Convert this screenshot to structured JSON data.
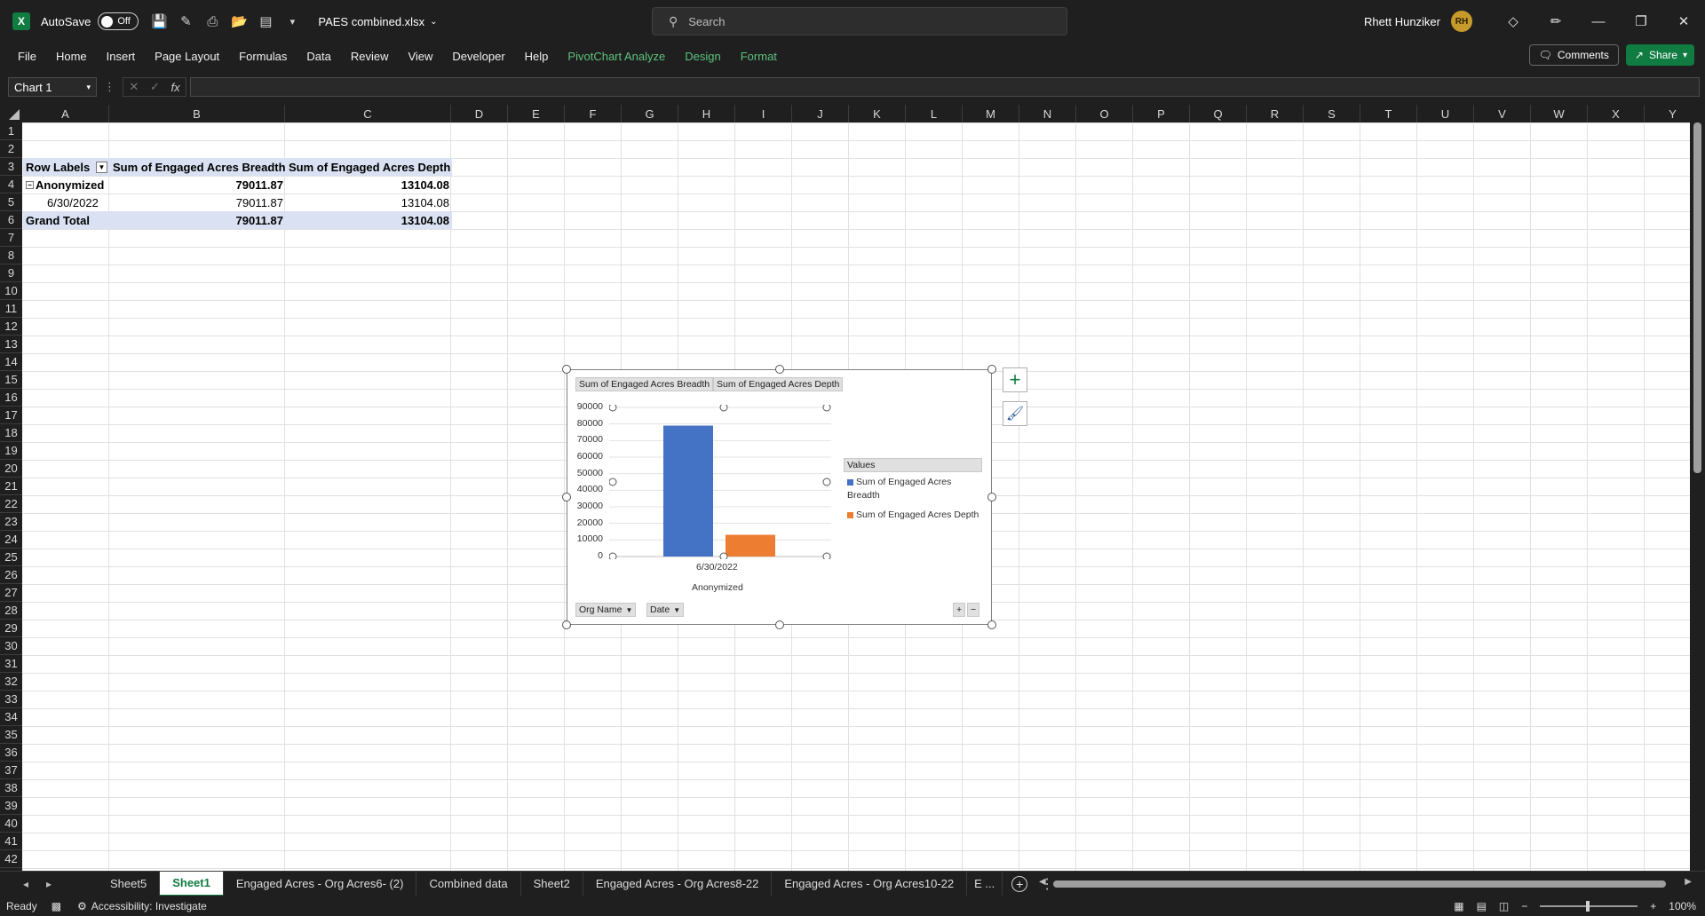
{
  "titlebar": {
    "autosave_label": "AutoSave",
    "autosave_state": "Off",
    "filename": "PAES combined.xlsx",
    "search_placeholder": "Search",
    "user_name": "Rhett Hunziker",
    "user_initials": "RH"
  },
  "menu": {
    "items": [
      "File",
      "Home",
      "Insert",
      "Page Layout",
      "Formulas",
      "Data",
      "Review",
      "View",
      "Developer",
      "Help"
    ],
    "context_items": [
      "PivotChart Analyze",
      "Design",
      "Format"
    ],
    "comments_label": "Comments",
    "share_label": "Share"
  },
  "formula_bar": {
    "name_box": "Chart 1",
    "fx": "fx",
    "value": ""
  },
  "columns": [
    "A",
    "B",
    "C",
    "D",
    "E",
    "F",
    "G",
    "H",
    "I",
    "J",
    "K",
    "L",
    "M",
    "N",
    "O",
    "P",
    "Q",
    "R",
    "S",
    "T",
    "U",
    "V",
    "W",
    "X",
    "Y"
  ],
  "rows": [
    "1",
    "2",
    "3",
    "4",
    "5",
    "6",
    "7",
    "8",
    "9",
    "10",
    "11",
    "12",
    "13",
    "14",
    "15",
    "16",
    "17",
    "18",
    "19",
    "20",
    "21",
    "22",
    "23",
    "24",
    "25",
    "26",
    "27",
    "28",
    "29",
    "30",
    "31",
    "32",
    "33",
    "34",
    "35",
    "36",
    "37",
    "38",
    "39",
    "40",
    "41",
    "42"
  ],
  "pivot": {
    "headers": [
      "Row Labels",
      "Sum of Engaged Acres Breadth",
      "Sum of Engaged Acres Depth"
    ],
    "group": {
      "label": "Anonymized",
      "breadth": "79011.87",
      "depth": "13104.08"
    },
    "item": {
      "label": "6/30/2022",
      "breadth": "79011.87",
      "depth": "13104.08"
    },
    "total": {
      "label": "Grand Total",
      "breadth": "79011.87",
      "depth": "13104.08"
    }
  },
  "chart_data": {
    "type": "bar",
    "categories": [
      "6/30/2022"
    ],
    "category_group": "Anonymized",
    "series": [
      {
        "name": "Sum of Engaged Acres Breadth",
        "values": [
          79011.87
        ],
        "color": "#4472c4"
      },
      {
        "name": "Sum of Engaged Acres Depth",
        "values": [
          13104.08
        ],
        "color": "#ed7d31"
      }
    ],
    "ylim": [
      0,
      90000
    ],
    "yticks": [
      "90000",
      "80000",
      "70000",
      "60000",
      "50000",
      "40000",
      "30000",
      "20000",
      "10000",
      "0"
    ],
    "legend_title": "Values",
    "legend_position": "right",
    "value_field_buttons": [
      "Sum of Engaged Acres Breadth",
      "Sum of Engaged Acres Depth"
    ],
    "axis_field_buttons": [
      "Org Name",
      "Date"
    ],
    "grid": true
  },
  "sheet_tabs": [
    "Sheet5",
    "Sheet1",
    "Engaged Acres - Org Acres6- (2)",
    "Combined data",
    "Sheet2",
    "Engaged Acres - Org Acres8-22",
    "Engaged Acres - Org Acres10-22",
    "E ..."
  ],
  "active_tab": "Sheet1",
  "status": {
    "ready": "Ready",
    "accessibility": "Accessibility: Investigate",
    "zoom": "100%"
  }
}
